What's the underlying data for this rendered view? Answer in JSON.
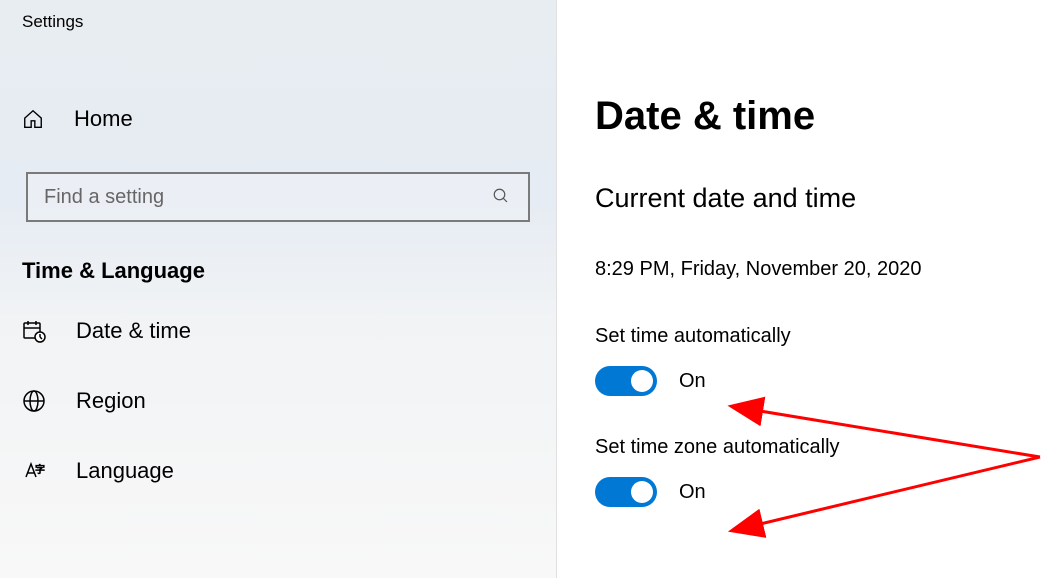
{
  "app": {
    "title": "Settings"
  },
  "sidebar": {
    "home_label": "Home",
    "search_placeholder": "Find a setting",
    "category": "Time & Language",
    "items": [
      {
        "label": "Date & time"
      },
      {
        "label": "Region"
      },
      {
        "label": "Language"
      }
    ]
  },
  "main": {
    "title": "Date & time",
    "section_heading": "Current date and time",
    "datetime": "8:29 PM, Friday, November 20, 2020",
    "settings": [
      {
        "label": "Set time automatically",
        "state": "On"
      },
      {
        "label": "Set time zone automatically",
        "state": "On"
      }
    ]
  }
}
